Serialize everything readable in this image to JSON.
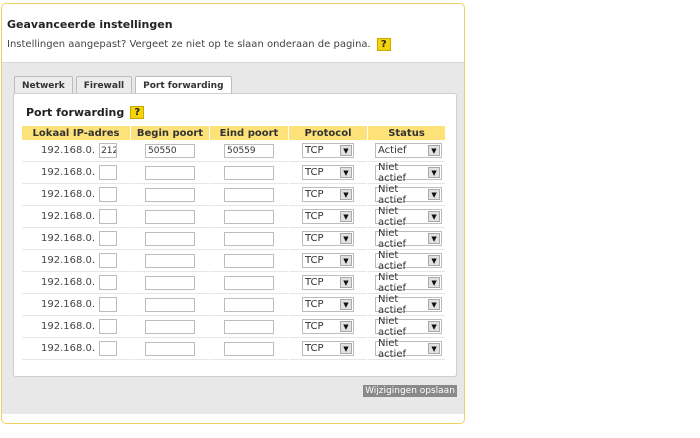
{
  "header": {
    "title": "Geavanceerde instellingen",
    "subtitle": "Instellingen aangepast? Vergeet ze niet op te slaan onderaan de pagina.",
    "help_label": "?"
  },
  "tabs": [
    {
      "label": "Netwerk",
      "active": false
    },
    {
      "label": "Firewall",
      "active": false
    },
    {
      "label": "Port forwarding",
      "active": true
    }
  ],
  "panel": {
    "title": "Port forwarding",
    "help_label": "?"
  },
  "table": {
    "columns": [
      "Lokaal IP-adres",
      "Begin poort",
      "Eind poort",
      "Protocol",
      "Status"
    ],
    "ip_prefix": "192.168.0.",
    "rows": [
      {
        "ip_last": "212",
        "begin": "50550",
        "end": "50559",
        "protocol": "TCP",
        "status": "Actief"
      },
      {
        "ip_last": "",
        "begin": "",
        "end": "",
        "protocol": "TCP",
        "status": "Niet actief"
      },
      {
        "ip_last": "",
        "begin": "",
        "end": "",
        "protocol": "TCP",
        "status": "Niet actief"
      },
      {
        "ip_last": "",
        "begin": "",
        "end": "",
        "protocol": "TCP",
        "status": "Niet actief"
      },
      {
        "ip_last": "",
        "begin": "",
        "end": "",
        "protocol": "TCP",
        "status": "Niet actief"
      },
      {
        "ip_last": "",
        "begin": "",
        "end": "",
        "protocol": "TCP",
        "status": "Niet actief"
      },
      {
        "ip_last": "",
        "begin": "",
        "end": "",
        "protocol": "TCP",
        "status": "Niet actief"
      },
      {
        "ip_last": "",
        "begin": "",
        "end": "",
        "protocol": "TCP",
        "status": "Niet actief"
      },
      {
        "ip_last": "",
        "begin": "",
        "end": "",
        "protocol": "TCP",
        "status": "Niet actief"
      },
      {
        "ip_last": "",
        "begin": "",
        "end": "",
        "protocol": "TCP",
        "status": "Niet actief"
      }
    ]
  },
  "footer": {
    "save_label": "Wijzigingen opslaan"
  },
  "colors": {
    "border_accent": "#f0d060",
    "header_row": "#fde27a",
    "help_icon": "#f5d30a",
    "save_button": "#8a8a8a"
  }
}
